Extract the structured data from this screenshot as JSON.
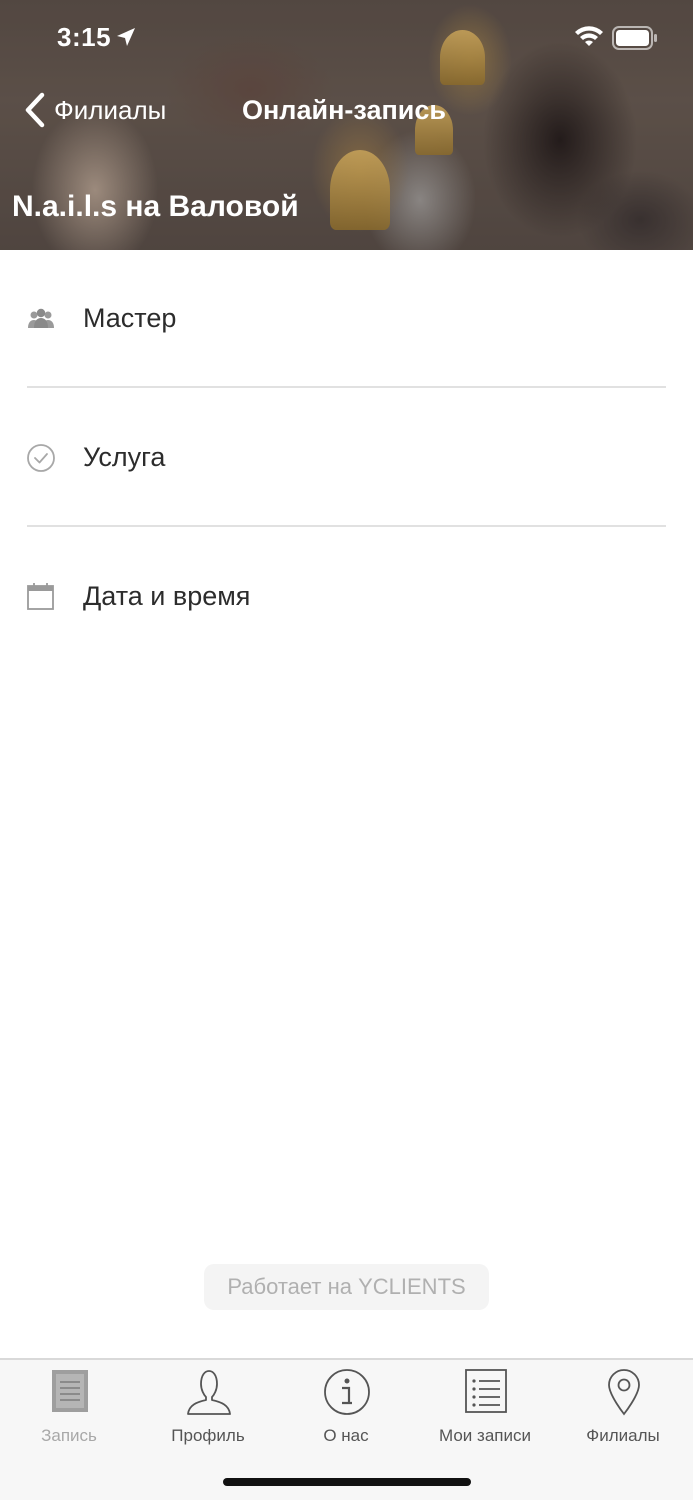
{
  "status_bar": {
    "time": "3:15"
  },
  "nav": {
    "back_label": "Филиалы",
    "title": "Онлайн-запись"
  },
  "branch": {
    "name": "N.a.i.l.s на Валовой"
  },
  "rows": [
    {
      "label": "Мастер",
      "icon": "people-icon"
    },
    {
      "label": "Услуга",
      "icon": "check-circle-icon"
    },
    {
      "label": "Дата и время",
      "icon": "calendar-icon"
    }
  ],
  "footer": {
    "powered_by": "Работает на YCLIENTS"
  },
  "tabbar": {
    "tabs": [
      {
        "label": "Запись",
        "icon": "document-icon",
        "active": false
      },
      {
        "label": "Профиль",
        "icon": "person-icon",
        "active": true
      },
      {
        "label": "О нас",
        "icon": "info-icon",
        "active": true
      },
      {
        "label": "Мои записи",
        "icon": "list-icon",
        "active": true
      },
      {
        "label": "Филиалы",
        "icon": "location-pin-icon",
        "active": true
      }
    ]
  },
  "colors": {
    "text": "#2c2c2c",
    "divider": "#e1e1e1",
    "tabbar_bg": "#f7f7f7",
    "inactive": "#a8a8a8"
  }
}
